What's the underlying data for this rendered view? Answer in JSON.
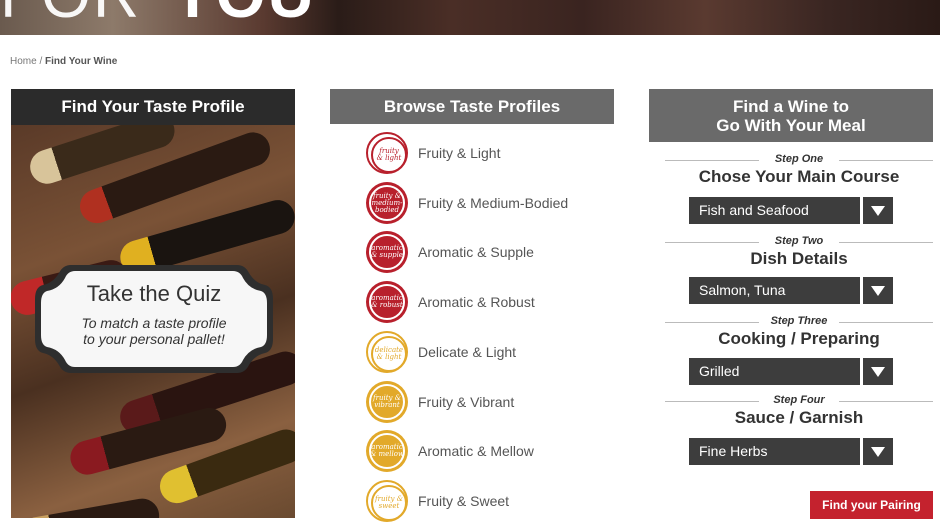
{
  "banner": {
    "text_thin": "FOR",
    "text_bold": "YOU"
  },
  "breadcrumb": {
    "home": "Home",
    "separator": " / ",
    "current": "Find Your Wine"
  },
  "taste_profile": {
    "heading": "Find Your Taste Profile",
    "quiz_title": "Take the Quiz",
    "quiz_subtitle_line1": "To match a taste profile",
    "quiz_subtitle_line2": "to your personal pallet!"
  },
  "browse": {
    "heading": "Browse Taste Profiles",
    "items": [
      {
        "label": "Fruity & Light",
        "badge_line1": "fruity",
        "badge_line2": "& light",
        "badge_line3": "",
        "style": "outline",
        "color": "#b8202c"
      },
      {
        "label": "Fruity & Medium-Bodied",
        "badge_line1": "fruity &",
        "badge_line2": "medium-",
        "badge_line3": "bodied",
        "style": "red",
        "color": "#b8202c"
      },
      {
        "label": "Aromatic & Supple",
        "badge_line1": "aromatic",
        "badge_line2": "& supple",
        "badge_line3": "",
        "style": "red",
        "color": "#b8202c"
      },
      {
        "label": "Aromatic & Robust",
        "badge_line1": "aromatic",
        "badge_line2": "& robust",
        "badge_line3": "",
        "style": "red",
        "color": "#b8202c"
      },
      {
        "label": "Delicate & Light",
        "badge_line1": "delicate",
        "badge_line2": "& light",
        "badge_line3": "",
        "style": "outline-g",
        "color": "#e2a92a"
      },
      {
        "label": "Fruity & Vibrant",
        "badge_line1": "fruity &",
        "badge_line2": "vibrant",
        "badge_line3": "",
        "style": "gold",
        "color": "#e2a92a"
      },
      {
        "label": "Aromatic & Mellow",
        "badge_line1": "aromatic",
        "badge_line2": "& mellow",
        "badge_line3": "",
        "style": "gold",
        "color": "#e2a92a"
      },
      {
        "label": "Fruity & Sweet",
        "badge_line1": "fruity &",
        "badge_line2": "sweet",
        "badge_line3": "",
        "style": "outline-g",
        "color": "#e2a92a"
      }
    ]
  },
  "pairing": {
    "heading_line1": "Find a Wine to",
    "heading_line2": "Go With Your Meal",
    "steps": [
      {
        "step": "Step One",
        "title": "Chose Your Main Course",
        "value": "Fish and Seafood"
      },
      {
        "step": "Step Two",
        "title": "Dish Details",
        "value": "Salmon, Tuna"
      },
      {
        "step": "Step Three",
        "title": "Cooking / Preparing",
        "value": "Grilled"
      },
      {
        "step": "Step Four",
        "title": "Sauce / Garnish",
        "value": "Fine Herbs"
      }
    ],
    "button": "Find your Pairing"
  },
  "colors": {
    "accent_red": "#c4222e",
    "badge_red": "#b8202c",
    "badge_gold": "#e2a92a",
    "header_dark": "#2b2b2b",
    "header_gray": "#6a6a6a",
    "select_bg": "#3d3d3d"
  }
}
